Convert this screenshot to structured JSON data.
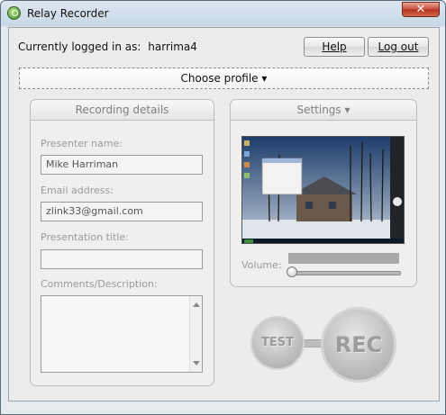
{
  "window": {
    "title": "Relay Recorder",
    "close_glyph": "✕"
  },
  "header": {
    "logged_in_label": "Currently logged in as:",
    "username": "harrima4",
    "help_label": "Help",
    "logout_label": "Log out"
  },
  "profile": {
    "label": "Choose profile",
    "arrow": "▾"
  },
  "recording_details": {
    "title": "Recording details",
    "presenter_label": "Presenter name:",
    "presenter_value": "Mike Harriman",
    "email_label": "Email address:",
    "email_value": "zlink33@gmail.com",
    "title_label": "Presentation title:",
    "title_value": "",
    "comments_label": "Comments/Description:",
    "comments_value": ""
  },
  "settings": {
    "title": "Settings",
    "arrow": "▾",
    "volume_label": "Volume:",
    "volume_level": 0.0
  },
  "controls": {
    "test_label": "TEST",
    "rec_label": "REC"
  },
  "icons": [
    "app-icon",
    "close-icon",
    "scroll-up-icon",
    "scroll-down-icon"
  ]
}
